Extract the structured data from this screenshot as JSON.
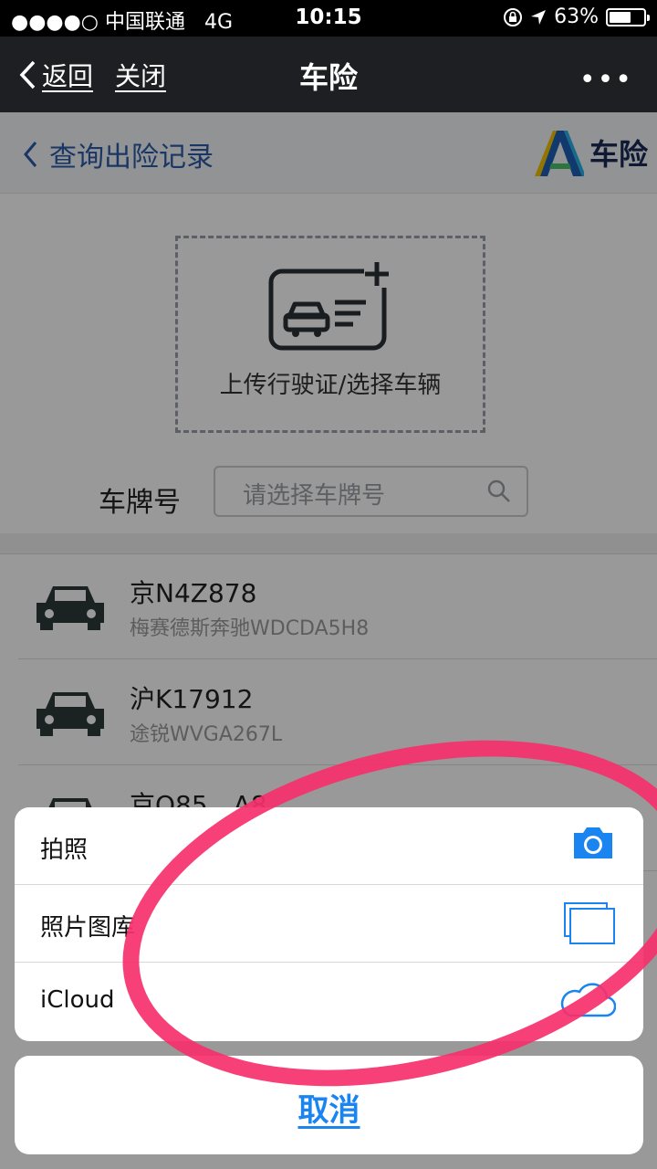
{
  "status_bar": {
    "signal": "●●●●○",
    "carrier": "中国联通",
    "network": "4G",
    "time": "10:15",
    "battery": "63%",
    "battery_level": 0.63
  },
  "nav": {
    "back_label": "返回",
    "close_label": "关闭",
    "title": "车险",
    "more": "•••"
  },
  "page_header": {
    "back_label": "查询出险记录",
    "logo_text": "车险"
  },
  "upload": {
    "caption": "上传行驶证/选择车辆"
  },
  "plate_search": {
    "label": "车牌号",
    "placeholder": "请选择车牌号"
  },
  "vehicles": [
    {
      "plate": "京N4Z878",
      "model": "梅赛德斯奔驰WDCDA5H8"
    },
    {
      "plate": "沪K17912",
      "model": "途锐WVGA267L"
    },
    {
      "plate": "京Q85__A8",
      "model": ""
    }
  ],
  "action_sheet": {
    "items": [
      {
        "label": "拍照",
        "icon": "camera-icon"
      },
      {
        "label": "照片图库",
        "icon": "photo-library-icon"
      },
      {
        "label": "iCloud",
        "icon": "icloud-icon"
      }
    ],
    "cancel_label": "取消"
  },
  "colors": {
    "accent_blue": "#1a84f0",
    "highlight_circle": "#f7306d",
    "link_blue": "#2a5aa8"
  }
}
